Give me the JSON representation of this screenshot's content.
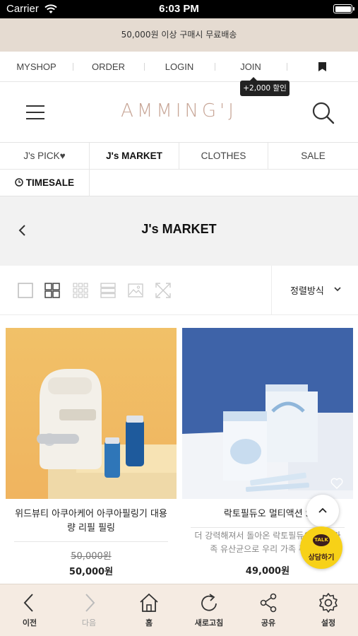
{
  "status_bar": {
    "carrier": "Carrier",
    "time": "6:03 PM"
  },
  "promo": {
    "text": "50,000원 이상 구매시 무료배송"
  },
  "top_nav": {
    "items": [
      "MYSHOP",
      "ORDER",
      "LOGIN",
      "JOIN"
    ],
    "tooltip": "+2,000 할인"
  },
  "header": {
    "logo": "AMMING'J"
  },
  "categories": {
    "tabs": [
      "J's PICK♥",
      "J's MARKET",
      "CLOTHES",
      "SALE"
    ],
    "timesale": "TIMESALE"
  },
  "page": {
    "title": "J's MARKET"
  },
  "toolbar": {
    "sort_label": "정렬방식"
  },
  "products": [
    {
      "name": "위드뷰티 아쿠아케어 아쿠아필링기 대용량 리필 필링",
      "original_price": "50,000원",
      "price": "50,000원"
    },
    {
      "name": "락토필듀오 멀티액션 S",
      "description": "더 강력해져서 돌아온 락토필듀오 S 온 가족 유산균으로 우리 가족 주세요!",
      "price": "49,000원"
    }
  ],
  "talk": {
    "bubble": "TALK",
    "label": "상담하기"
  },
  "bottom_bar": {
    "items": [
      "이전",
      "다음",
      "홈",
      "새로고침",
      "공유",
      "설정"
    ]
  },
  "colors": {
    "promo_bg": "#e5dbd1",
    "logo": "#c7a596",
    "talk": "#f7d117",
    "bottom_bg": "#f5ebe2"
  }
}
